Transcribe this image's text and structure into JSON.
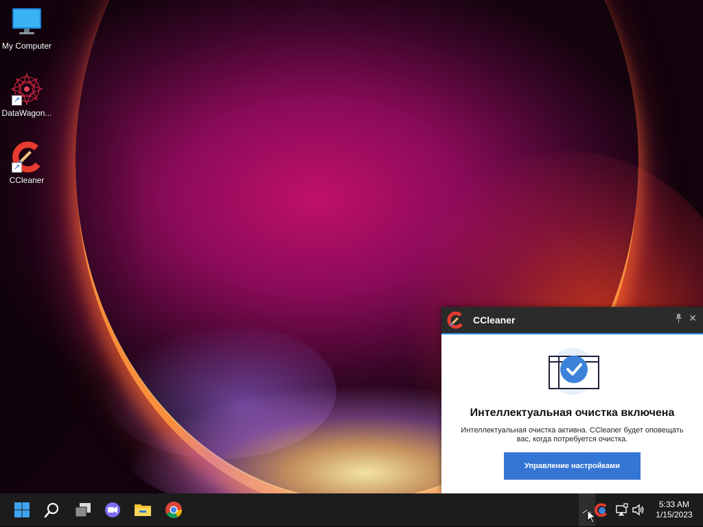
{
  "desktop_icons": [
    {
      "label": "My Computer",
      "icon": "monitor-icon"
    },
    {
      "label": "DataWagon...",
      "icon": "datawagon-mandala-icon"
    },
    {
      "label": "CCleaner",
      "icon": "ccleaner-icon"
    }
  ],
  "notification": {
    "app_name": "CCleaner",
    "title": "Интеллектуальная очистка включена",
    "message": "Интеллектуальная очистка активна. CCleaner будет оповещать вас, когда потребуется очистка.",
    "button_label": "Управление настройками",
    "pin_icon": "pin-icon",
    "close_icon": "close-icon"
  },
  "taskbar": {
    "items": [
      "start-icon",
      "search-icon",
      "task-view-icon",
      "chat-icon",
      "file-explorer-icon",
      "chrome-icon"
    ],
    "tray": [
      "chevron-up-icon",
      "ccleaner-tray-icon",
      "network-icon",
      "volume-icon"
    ],
    "clock": {
      "time": "5:33 AM",
      "date": "1/15/2023"
    }
  },
  "colors": {
    "accent_blue": "#3575d3",
    "taskbar_bg": "#1c1c1c",
    "toast_header_bg": "#2b2b2b"
  }
}
